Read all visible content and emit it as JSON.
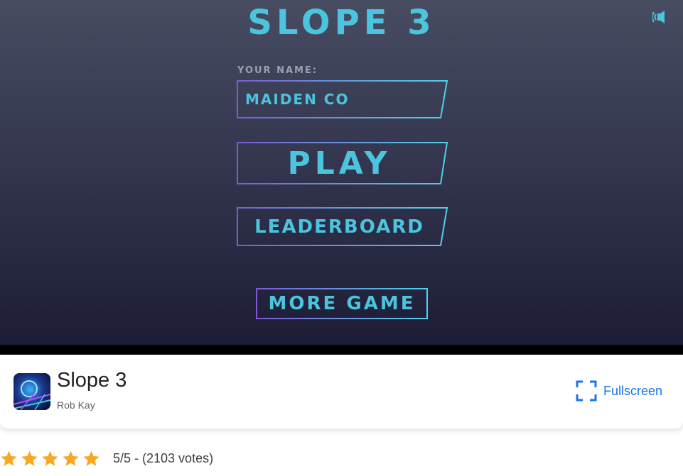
{
  "game": {
    "title": "Slope 3",
    "sound_icon": "speaker-icon",
    "name_label": "YOUR NAME:",
    "name_value": "MAIDEN CO",
    "play_label": "PLAY",
    "leaderboard_label": "LEADERBOARD",
    "more_game_label": "MORE GAME",
    "accent_color": "#4bc4dd"
  },
  "info": {
    "title": "Slope 3",
    "author": "Rob Kay",
    "fullscreen_label": "Fullscreen",
    "fullscreen_icon": "fullscreen-icon"
  },
  "rating": {
    "stars": 5,
    "max": 5,
    "text": "5/5 - (2103 votes)",
    "star_color": "#f9a825"
  }
}
